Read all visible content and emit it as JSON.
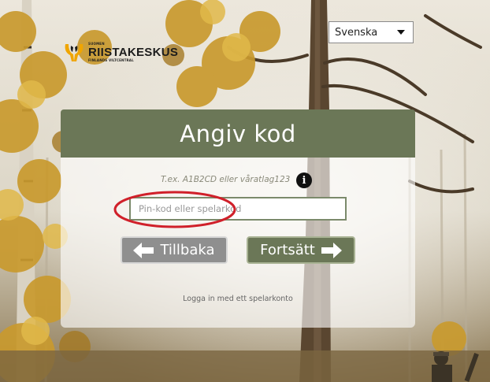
{
  "language_select": {
    "selected": "Svenska"
  },
  "logo": {
    "small_line": "SUOMEN",
    "name": "RIISTAKESKUS",
    "subtitle": "FINLANDS VILTCENTRAL"
  },
  "dialog": {
    "title": "Angiv kod",
    "hint": "T.ex. A1B2CD eller våratlag123",
    "info_icon_glyph": "i",
    "input_placeholder": "Pin-kod eller spelarkod",
    "input_value": "",
    "back_label": "Tillbaka",
    "next_label": "Fortsätt",
    "login_link": "Logga in med ett spelarkonto"
  },
  "colors": {
    "header_green": "#6b7757",
    "back_gray": "#8f8f8f",
    "annotation_red": "#d0202a"
  },
  "icons": {
    "back": "arrow-left-icon",
    "next": "arrow-right-icon",
    "info": "info-icon",
    "dropdown": "chevron-down-icon"
  }
}
